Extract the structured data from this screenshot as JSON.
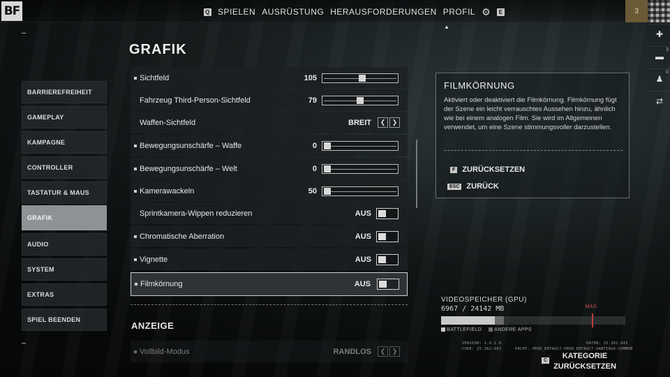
{
  "logo": "BF",
  "nav": {
    "key_left": "Q",
    "items": [
      "SPIELEN",
      "AUSRÜSTUNG",
      "HERAUSFORDERUNGEN",
      "PROFIL"
    ],
    "key_right": "E",
    "level": "3"
  },
  "rail": {
    "count1": "3",
    "count2": "0"
  },
  "menu": {
    "items": [
      "BARRIEREFREIHEIT",
      "GAMEPLAY",
      "KAMPAGNE",
      "CONTROLLER",
      "TASTATUR & MAUS",
      "GRAFIK",
      "AUDIO",
      "SYSTEM",
      "EXTRAS",
      "SPIEL BEENDEN"
    ],
    "active": "GRAFIK"
  },
  "page": {
    "title": "GRAFIK",
    "section2": "ANZEIGE"
  },
  "settings": [
    {
      "label": "Sichtfeld",
      "type": "slider",
      "value": "105",
      "level": 0.52,
      "bullet": true
    },
    {
      "label": "Fahrzeug Third-Person-Sichtfeld",
      "type": "slider",
      "value": "79",
      "level": 0.49,
      "bullet": false
    },
    {
      "label": "Waffen-Sichtfeld",
      "type": "select",
      "value": "BREIT",
      "bullet": false
    },
    {
      "label": "Bewegungsunschärfe – Waffe",
      "type": "slider",
      "value": "0",
      "level": 0.0,
      "bullet": true
    },
    {
      "label": "Bewegungsunschärfe – Welt",
      "type": "slider",
      "value": "0",
      "level": 0.0,
      "bullet": true
    },
    {
      "label": "Kamerawackeln",
      "type": "slider",
      "value": "50",
      "level": 0.0,
      "bullet": true
    },
    {
      "label": "Sprintkamera-Wippen reduzieren",
      "type": "toggle",
      "value": "AUS",
      "bullet": false
    },
    {
      "label": "Chromatische Aberration",
      "type": "toggle",
      "value": "AUS",
      "bullet": true
    },
    {
      "label": "Vignette",
      "type": "toggle",
      "value": "AUS",
      "bullet": true
    },
    {
      "label": "Filmkörnung",
      "type": "toggle",
      "value": "AUS",
      "bullet": true,
      "highlighted": true
    }
  ],
  "display_row": {
    "label": "Vollbild-Modus",
    "value": "RANDLOS"
  },
  "info": {
    "title": "FILMKÖRNUNG",
    "description": "Aktiviert oder deaktiviert die Filmkörnung. Filmkörnung fügt der Szene ein leicht verrauschtes Aussehen hinzu, ähnlich wie bei einem analogen Film. Sie wird im Allgemeinen verwendet, um eine Szene stimmungsvoller darzustellen.",
    "reset_key": "F",
    "reset_label": "ZURÜCKSETZEN",
    "back_key": "ESC",
    "back_label": "ZURÜCK"
  },
  "vram": {
    "title": "VIDEOSPEICHER (GPU)",
    "usage": "6967 / 24142 MB",
    "battlefield_fraction": 0.29,
    "other_fraction": 0.05,
    "max_fraction": 0.82,
    "max_label": "MAX.",
    "legend_battlefield": "BATTLEFIELD",
    "legend_other": "ANDERE APPS"
  },
  "meta": {
    "version": "VERSION: 1.0.1.0",
    "code": "CODE: 25.362.943",
    "date": "DATEN: 25.362.943",
    "patch": "PACHT: PROD_DEFAULT-PROD_DEFAULT-SANTIAGO-COMMON"
  },
  "category_reset": {
    "key": "C",
    "line1": "KATEGORIE",
    "line2": "ZURÜCKSETZEN"
  },
  "colors": {
    "accent_max": "#c0403a",
    "level_badge": "#6a5a36",
    "active_menu": "#8e9294"
  }
}
